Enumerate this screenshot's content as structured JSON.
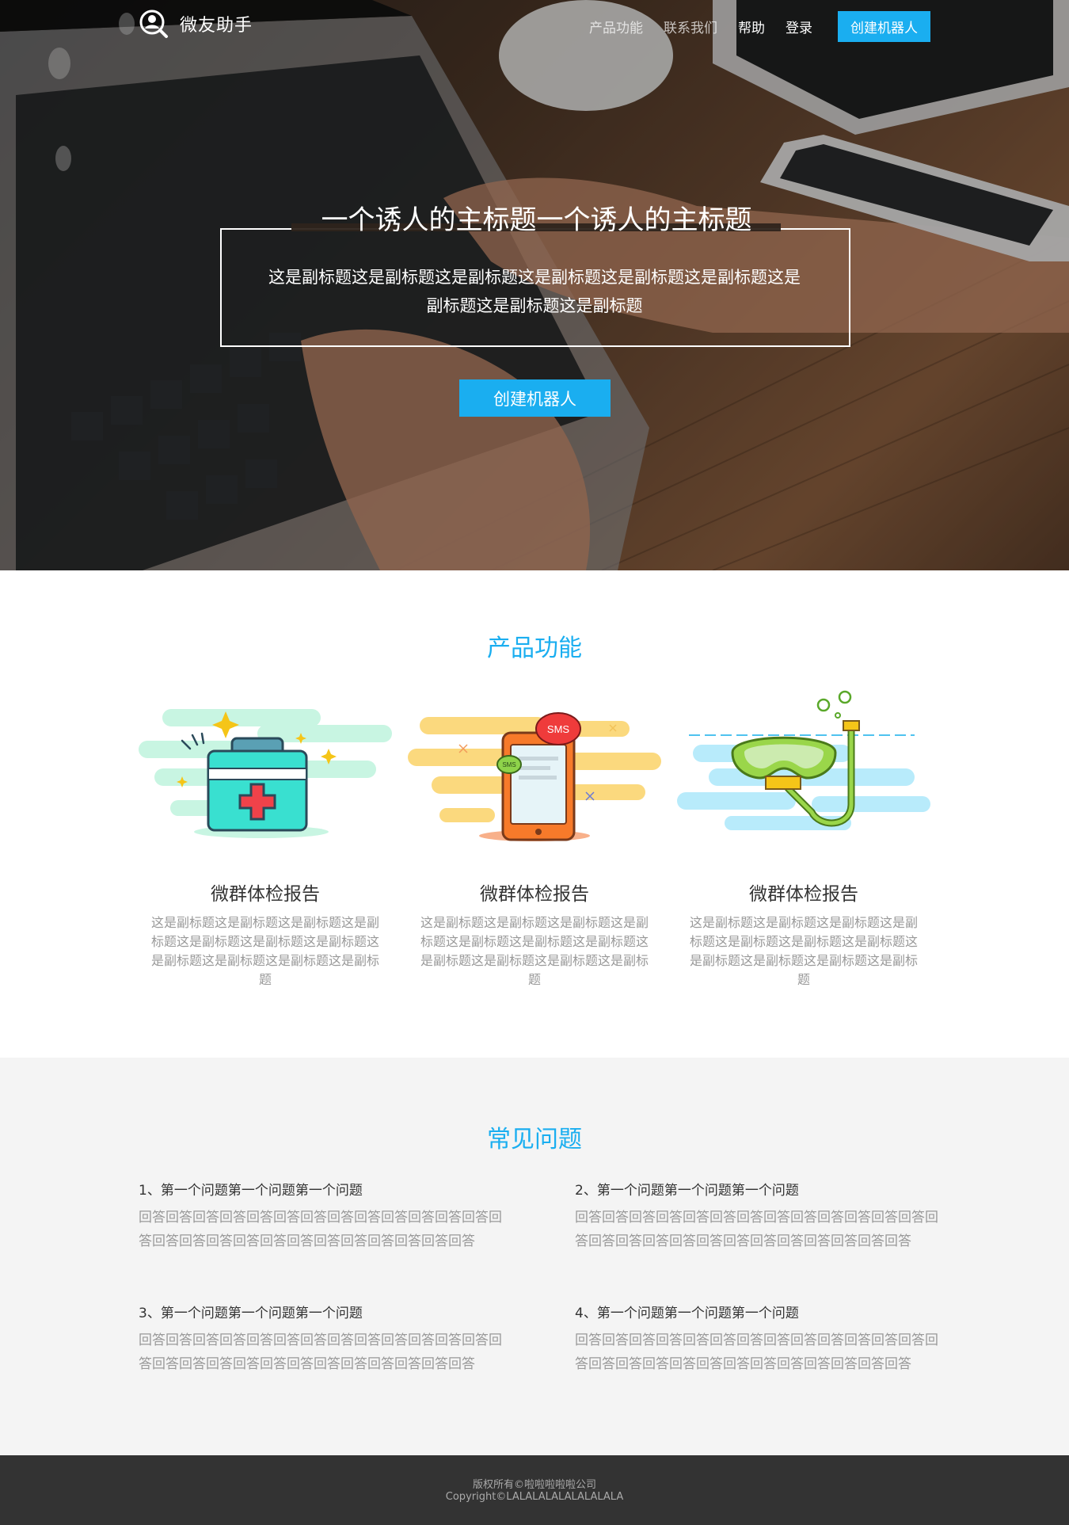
{
  "brand": {
    "name": "微友助手",
    "logo_icon": "user-search-icon"
  },
  "nav": {
    "items": [
      "产品功能",
      "联系我们",
      "帮助",
      "登录"
    ],
    "cta": "创建机器人"
  },
  "hero": {
    "title": "一个诱人的主标题一个诱人的主标题",
    "subtitle": "这是副标题这是副标题这是副标题这是副标题这是副标题这是副标题这是副标题这是副标题这是副标题",
    "button": "创建机器人"
  },
  "features": {
    "title": "产品功能",
    "items": [
      {
        "icon": "medical-kit-icon",
        "title": "微群体检报告",
        "desc": "这是副标题这是副标题这是副标题这是副标题这是副标题这是副标题这是副标题这是副标题这是副标题这是副标题这是副标题"
      },
      {
        "icon": "sms-phone-icon",
        "title": "微群体检报告",
        "desc": "这是副标题这是副标题这是副标题这是副标题这是副标题这是副标题这是副标题这是副标题这是副标题这是副标题这是副标题"
      },
      {
        "icon": "snorkel-mask-icon",
        "title": "微群体检报告",
        "desc": "这是副标题这是副标题这是副标题这是副标题这是副标题这是副标题这是副标题这是副标题这是副标题这是副标题这是副标题"
      }
    ]
  },
  "faq": {
    "title": "常见问题",
    "items": [
      {
        "q": "1、第一个问题第一个问题第一个问题",
        "a": "回答回答回答回答回答回答回答回答回答回答回答回答回答回答回答回答回答回答回答回答回答回答回答回答回答回答"
      },
      {
        "q": "2、第一个问题第一个问题第一个问题",
        "a": "回答回答回答回答回答回答回答回答回答回答回答回答回答回答回答回答回答回答回答回答回答回答回答回答回答回答"
      },
      {
        "q": "3、第一个问题第一个问题第一个问题",
        "a": "回答回答回答回答回答回答回答回答回答回答回答回答回答回答回答回答回答回答回答回答回答回答回答回答回答回答"
      },
      {
        "q": "4、第一个问题第一个问题第一个问题",
        "a": "回答回答回答回答回答回答回答回答回答回答回答回答回答回答回答回答回答回答回答回答回答回答回答回答回答回答"
      }
    ]
  },
  "footer": {
    "line1": "版权所有©啦啦啦啦啦公司",
    "line2": "Copyright©LALALALALALALALALA"
  },
  "colors": {
    "accent": "#1aaef0",
    "footer_bg": "#333333",
    "faq_bg": "#f4f4f4"
  }
}
